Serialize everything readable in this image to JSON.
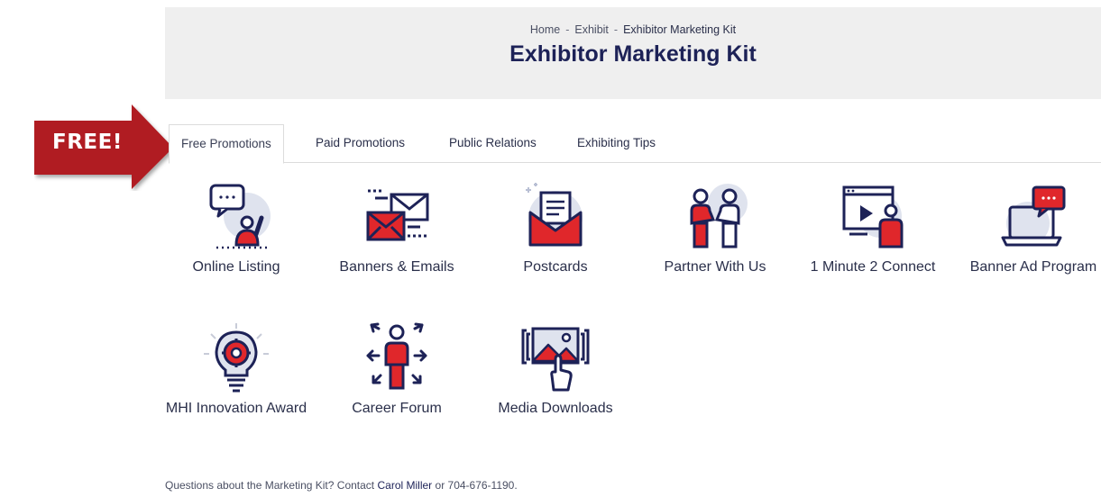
{
  "breadcrumb": {
    "home": "Home",
    "sep": "-",
    "exhibit": "Exhibit",
    "current": "Exhibitor Marketing Kit"
  },
  "page_title": "Exhibitor Marketing Kit",
  "callout": {
    "label": "FREE!",
    "color": "#b01e23"
  },
  "tabs": [
    {
      "label": "Free Promotions",
      "active": true
    },
    {
      "label": "Paid Promotions"
    },
    {
      "label": "Public Relations"
    },
    {
      "label": "Exhibiting Tips"
    }
  ],
  "tiles": [
    {
      "label": "Online Listing",
      "icon": "chat-person-icon"
    },
    {
      "label": "Banners & Emails",
      "icon": "envelopes-icon"
    },
    {
      "label": "Postcards",
      "icon": "postcard-envelope-icon"
    },
    {
      "label": "Partner With Us",
      "icon": "handshake-people-icon"
    },
    {
      "label": "1 Minute 2 Connect",
      "icon": "video-presenter-icon"
    },
    {
      "label": "Banner Ad Program",
      "icon": "laptop-ad-icon"
    },
    {
      "label": "MHI Innovation Award",
      "icon": "lightbulb-gear-icon"
    },
    {
      "label": "Career Forum",
      "icon": "career-network-icon"
    },
    {
      "label": "Media Downloads",
      "icon": "image-touch-icon"
    }
  ],
  "footer": {
    "text_before": "Questions about the Marketing Kit? Contact",
    "link": "Carol Miller",
    "text_after": "or 704-676-1190."
  },
  "colors": {
    "navy": "#1d2257",
    "red": "#e0272b",
    "light_blue": "#dfe3ee"
  }
}
